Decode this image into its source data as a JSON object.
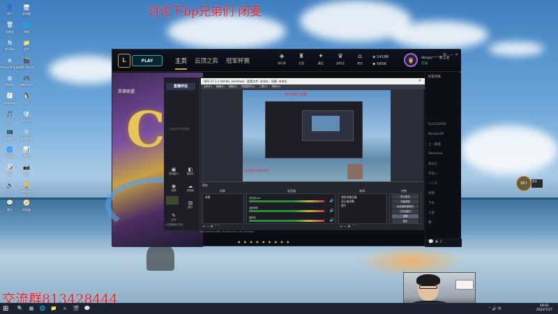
{
  "overlay": {
    "top_text": "讨论下bp兄弟们 闭麦",
    "bottom_text": "交流群813428444"
  },
  "desktop_icons": [
    {
      "glyph": "👤",
      "label": "用户"
    },
    {
      "glyph": "🖥",
      "label": "此电脑"
    },
    {
      "glyph": "🗑",
      "label": "回收站"
    },
    {
      "glyph": "🌐",
      "label": "网络"
    },
    {
      "glyph": "N",
      "label": "NVIDIA"
    },
    {
      "glyph": "📁",
      "label": "文件"
    },
    {
      "glyph": "e",
      "label": "Microsoft Edge"
    },
    {
      "glyph": "🎬",
      "label": "OBS Studio"
    },
    {
      "glyph": "⚙",
      "label": "Steam"
    },
    {
      "glyph": "🎮",
      "label": "WeGame"
    },
    {
      "glyph": "🅿",
      "label": "Potplayer"
    },
    {
      "glyph": "🐧",
      "label": "QQ"
    },
    {
      "glyph": "🎵",
      "label": "音乐"
    },
    {
      "glyph": "🛡",
      "label": "安全中心"
    },
    {
      "glyph": "📺",
      "label": "直播伴侣"
    },
    {
      "glyph": "⚔",
      "label": "英雄联盟"
    },
    {
      "glyph": "🌀",
      "label": "加速器"
    },
    {
      "glyph": "📊",
      "label": "数据"
    },
    {
      "glyph": "🎲",
      "label": "游戏"
    },
    {
      "glyph": "📷",
      "label": "截图"
    },
    {
      "glyph": "🔊",
      "label": "声音"
    },
    {
      "glyph": "🏆",
      "label": "WeGame"
    },
    {
      "glyph": "💬",
      "label": "聊天"
    },
    {
      "glyph": "🧭",
      "label": "浏览器"
    }
  ],
  "client": {
    "logo": "L",
    "play_label": "PLAY",
    "tabs": [
      "主页",
      "云顶之弈",
      "冠军杯赛"
    ],
    "icons": [
      {
        "glyph": "◈",
        "label": "排行榜"
      },
      {
        "glyph": "♜",
        "label": "生涯"
      },
      {
        "glyph": "✦",
        "label": "藏品"
      },
      {
        "glyph": "♛",
        "label": "战利品"
      },
      {
        "glyph": "⌂",
        "label": "商店"
      }
    ],
    "currency_blue": "14186",
    "currency_orange": "5656",
    "avatar_glyph": "🦉",
    "username": "douyu一一家之言",
    "user_status": "在线",
    "banner_title": "英雄联盟",
    "banner_letter": "C",
    "banner_label": "全新版本",
    "banner_dots": "● ● ● ● ● ● ● ● ●",
    "social_head": "好友列表",
    "social_items": [
      "SL4254030",
      "Bbradcdff",
      "上一家族",
      "Pokeman",
      "杀必仁",
      "不见一",
      "一二三",
      "汤溺",
      "下丸",
      "人说",
      "幂"
    ],
    "social_foot": "💬 ⊕ ♪"
  },
  "obs": {
    "title": "OBS 27.1.3 (64-bit, windows) - 配置文件: 未命名 - 场景: 未命名",
    "menu": "文件(F) 编辑(E) 视图(V) 停靠部件(D) 工具(T) 帮助(H)",
    "preview_text": "有片源在 闭麦",
    "preview_text2": "交流群813428444",
    "dock_headers": [
      "场景",
      "来源",
      "混音器",
      "转场特效",
      "控制"
    ],
    "scene": "场景",
    "sources": [
      "视频采集设备",
      "显示器采集",
      "图片"
    ],
    "mixer": [
      {
        "label": "麦克风/Aux",
        "icon": "🔊"
      },
      {
        "label": "桌面音频",
        "icon": "🔊"
      },
      {
        "label": "媒体源",
        "icon": "🔊"
      }
    ],
    "controls": [
      "停止推流",
      "开始录制",
      "启动虚拟摄像机",
      "工作室模式",
      "设置",
      "退出"
    ],
    "status": "LIVE: 00:00:00  REC: 00:00:00  CPU: 1.3%, 60.00 fps",
    "preview_label": "预览",
    "tools": "+ − ⚙ ˄ ˅"
  },
  "helper": {
    "logo": "直播伴侣",
    "hint": "添加素材开始直播",
    "buttons": [
      {
        "glyph": "▣",
        "label": "游戏窗口"
      },
      {
        "glyph": "◧",
        "label": "摄像头"
      },
      {
        "glyph": "◉",
        "label": "录屏"
      },
      {
        "glyph": "☁",
        "label": "多媒体"
      },
      {
        "glyph": "▤",
        "label": "图片"
      },
      {
        "glyph": "✎",
        "label": "文字"
      }
    ],
    "footer": "公告直播间已开启"
  },
  "gold_badge": "18↑",
  "gold_badge_text": "更多",
  "taskbar": {
    "start": "⊞",
    "apps": [
      "🔍",
      "▦",
      "🌐",
      "📁",
      "⚔",
      "🎬",
      "💬"
    ],
    "tray": "⌃ 🔊 中",
    "time": "18:02",
    "date": "2022/7/27"
  }
}
